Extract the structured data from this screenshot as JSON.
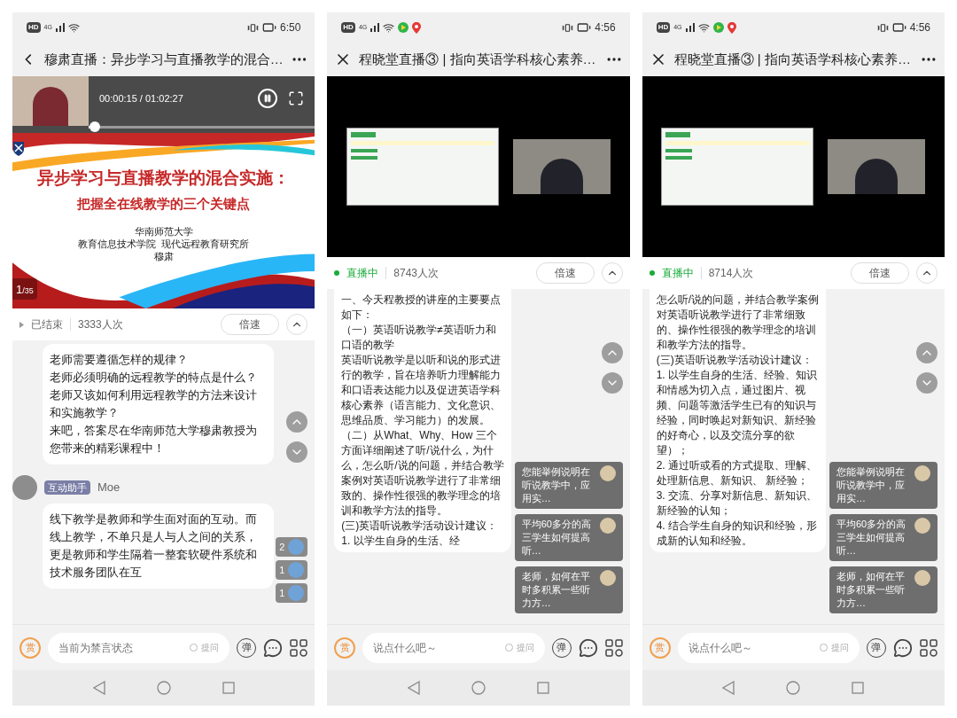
{
  "phones": [
    {
      "status_bar": {
        "hd": "HD",
        "network": "4G",
        "app_notifications": false,
        "time": "6:50"
      },
      "title_bar": {
        "kind": "back",
        "title": "穆肃直播：异步学习与直播教学的混合…"
      },
      "video": {
        "kind": "slides",
        "time": "00:00:15 / 01:02:27",
        "playing": true,
        "level": 0.004,
        "slide": {
          "title": "异步学习与直播教学的混合实施：",
          "subtitle": "把握全在线教学的三个关键点",
          "credits": [
            "华南师范大学",
            "教育信息技术学院  现代远程教育研究所",
            "穆肃"
          ],
          "page": "1",
          "total": "/35"
        }
      },
      "info_bar": {
        "status": "已结束",
        "live": false,
        "views": "3333人次",
        "speed_button": "倍速"
      },
      "messages": [
        {
          "paragraphs": [
            "老师需要遵循怎样的规律？",
            "老师必须明确的远程教学的特点是什么？",
            "老师又该如何利用远程教学的方法来设计和实施教学？",
            "来吧，答案尽在华南师范大学穆肃教授为您带来的精彩课程中！"
          ]
        },
        {
          "author": {
            "badge": "互动助手",
            "name": "Moe"
          },
          "paragraphs": [
            "线下教学是教师和学生面对面的互动。而线上教学，不单只是人与人之间的关系，更是教师和学生隔着一整套软硬件系统和技术服务团队在互"
          ]
        }
      ],
      "reactions": [
        {
          "count": "2"
        },
        {
          "count": "1"
        },
        {
          "count": "1"
        }
      ],
      "input": {
        "reward": "赏",
        "placeholder": "当前为禁言状态",
        "ask_label": "提问",
        "ask_checked": false,
        "danmaku_button": "弹"
      }
    },
    {
      "status_bar": {
        "hd": "HD",
        "network": "4G",
        "app_notifications": true,
        "time": "4:56"
      },
      "title_bar": {
        "kind": "close",
        "title": "程晓堂直播③ | 指向英语学科核心素养…"
      },
      "video": {
        "kind": "screen_share"
      },
      "info_bar": {
        "status": "直播中",
        "live": true,
        "views": "8743人次",
        "speed_button": "倍速"
      },
      "messages": [
        {
          "paragraphs": [
            "一、今天程教授的讲座的主要要点如下：",
            "（一）英语听说教学≠英语听力和口语的教学",
            "英语听说教学是以听和说的形式进行的教学，旨在培养听力理解能力和口语表达能力以及促进英语学科核心素养（语言能力、文化意识、思维品质、学习能力）的发展。",
            "（二）从What、Why、How 三个方面详细阐述了听/说什么，为什么，怎么听/说的问题，并结合教学案例对英语听说教学进行了非常细致的、操作性很强的教学理念的培训和教学方法的指导。",
            "(三)英语听说教学活动设计建议：",
            "1. 以学生自身的生活、经"
          ]
        }
      ],
      "questions": [
        {
          "text": "您能举例说明在听说教学中，应用实…"
        },
        {
          "text": "平均60多分的高三学生如何提高听…"
        },
        {
          "text": "老师，如何在平时多积累一些听力方…"
        }
      ],
      "input": {
        "reward": "赏",
        "placeholder": "说点什么吧～",
        "ask_label": "提问",
        "ask_checked": false,
        "danmaku_button": "弹"
      }
    },
    {
      "status_bar": {
        "hd": "HD",
        "network": "4G",
        "app_notifications": true,
        "time": "4:56"
      },
      "title_bar": {
        "kind": "close",
        "title": "程晓堂直播③ | 指向英语学科核心素养…"
      },
      "video": {
        "kind": "screen_share"
      },
      "info_bar": {
        "status": "直播中",
        "live": true,
        "views": "8714人次",
        "speed_button": "倍速"
      },
      "messages": [
        {
          "paragraphs": [
            "怎么听/说的问题，并结合教学案例对英语听说教学进行了非常细致的、操作性很强的教学理念的培训和教学方法的指导。",
            "(三)英语听说教学活动设计建议：",
            "1. 以学生自身的生活、经验、知识和情感为切入点，通过图片、视频、问题等激活学生已有的知识与经验，同时唤起对新知识、新经验的好奇心，以及交流分享的欲望）；",
            "2. 通过听或看的方式提取、理解、处理新信息、新知识、 新经验；",
            "3. 交流、分享对新信息、新知识、新经验的认知；",
            "4. 结合学生自身的知识和经验，形成新的认知和经验。"
          ]
        }
      ],
      "questions": [
        {
          "text": "您能举例说明在听说教学中，应用实…"
        },
        {
          "text": "平均60多分的高三学生如何提高听…"
        },
        {
          "text": "老师，如何在平时多积累一些听力方…"
        }
      ],
      "input": {
        "reward": "赏",
        "placeholder": "说点什么吧～",
        "ask_label": "提问",
        "ask_checked": false,
        "danmaku_button": "弹"
      }
    }
  ]
}
